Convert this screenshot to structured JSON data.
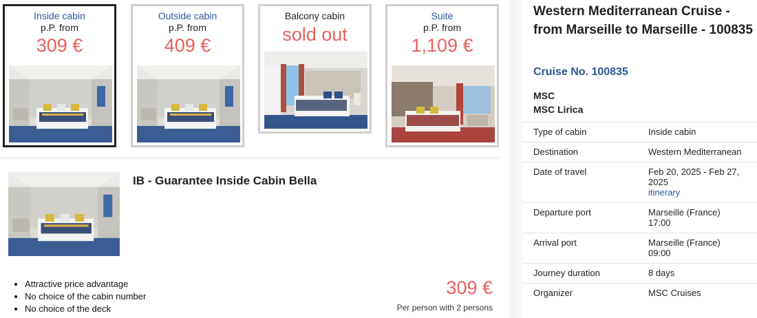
{
  "cabins": [
    {
      "name": "Inside cabin",
      "pp": "p.P. from",
      "price": "309 €",
      "selected": true
    },
    {
      "name": "Outside cabin",
      "pp": "p.P. from",
      "price": "409 €",
      "selected": false
    },
    {
      "name": "Balcony cabin",
      "status": "sold out",
      "selected": false
    },
    {
      "name": "Suite",
      "pp": "p.P. from",
      "price": "1,109 €",
      "selected": false
    }
  ],
  "detail": {
    "title": "IB - Guarantee Inside Cabin Bella",
    "bullets": [
      "Attractive price advantage",
      "No choice of the cabin number",
      "No choice of the deck"
    ],
    "price": "309 €",
    "price_note": "Per person with 2 persons"
  },
  "cruise": {
    "title": "Western Mediterranean Cruise - from Marseille to Marseille - 100835",
    "number": "Cruise No. 100835",
    "line": "MSC",
    "ship": "MSC Lirica",
    "rows": [
      {
        "key": "Type of cabin",
        "value": "Inside cabin"
      },
      {
        "key": "Destination",
        "value": "Western Mediterranean"
      },
      {
        "key": "Date of travel",
        "value": "Feb 20, 2025 - Feb 27, 2025",
        "link": "itinerary"
      },
      {
        "key": "Departure port",
        "value": "Marseille (France)",
        "value2": "17:00"
      },
      {
        "key": "Arrival port",
        "value": "Marseille (France)",
        "value2": "09:00"
      },
      {
        "key": "Journey duration",
        "value": "8 days"
      },
      {
        "key": "Organizer",
        "value": "MSC Cruises"
      }
    ]
  },
  "colors": {
    "accent_price": "#e9605b",
    "link_blue": "#2d5596",
    "selected_border": "#222222",
    "card_border": "#d0d0d0"
  },
  "images": [
    "inside-cabin-photo",
    "outside-cabin-photo",
    "balcony-cabin-photo",
    "suite-photo",
    "detail-inside-cabin-photo"
  ]
}
